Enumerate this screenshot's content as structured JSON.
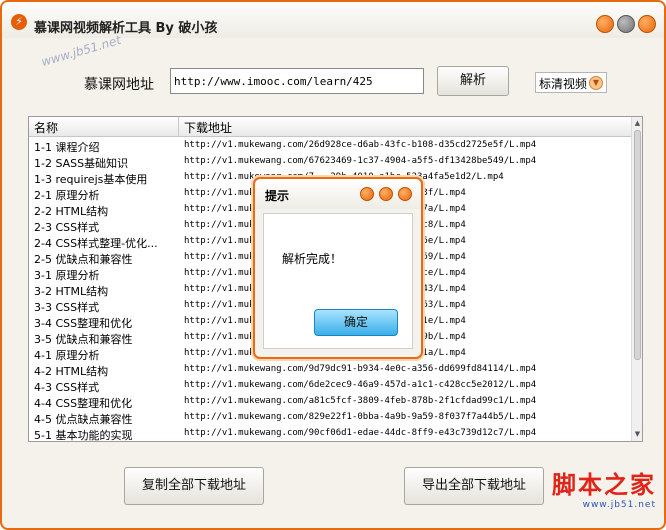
{
  "window": {
    "title": "慕课网视频解析工具 By 破小孩",
    "app_icon_glyph": "⚡",
    "watermark": "www.jb51.net"
  },
  "form": {
    "url_label": "慕课网地址",
    "url_value": "http://www.imooc.com/learn/425",
    "parse_button": "解析",
    "quality_selected": "标清视频"
  },
  "list": {
    "headers": {
      "name": "名称",
      "url": "下载地址"
    },
    "rows": [
      {
        "name": "1-1 课程介绍",
        "url": "http://v1.mukewang.com/26d928ce-d6ab-43fc-b108-d35cd2725e5f/L.mp4"
      },
      {
        "name": "1-2 SASS基础知识",
        "url": "http://v1.mukewang.com/67623469-1c37-4904-a5f5-df13428be549/L.mp4"
      },
      {
        "name": "1-3 requirejs基本使用",
        "url": "http://v1.mukewang.com/7...29b-4010-a1bc-523a4fa5e1d2/L.mp4"
      },
      {
        "name": "2-1 原理分析",
        "url": "http://v1.mukewang.com/...ae-a4f3-bef4d6c66a3f/L.mp4"
      },
      {
        "name": "2-2 HTML结构",
        "url": "http://v1.mukewang.com/...79-ab53-ecaa0d05497a/L.mp4"
      },
      {
        "name": "2-3 CSS样式",
        "url": "http://v1.mukewang.com/...43-874d-fddefe4347c8/L.mp4"
      },
      {
        "name": "2-4 CSS样式整理-优化...",
        "url": "http://v1.mukewang.com/...43-96e9-9693299f706e/L.mp4"
      },
      {
        "name": "2-5 优缺点和兼容性",
        "url": "http://v1.mukewang.com/...fd-98fb-f21667e65f69/L.mp4"
      },
      {
        "name": "3-1 原理分析",
        "url": "http://v1.mukewang.com/...ee-ac2c-ab5fac0104ce/L.mp4"
      },
      {
        "name": "3-2 HTML结构",
        "url": "http://v1.mukewang.com/...b0-8908-0624a6c41c43/L.mp4"
      },
      {
        "name": "3-3 CSS样式",
        "url": "http://v1.mukewang.com/...b1-888d-705993f85a63/L.mp4"
      },
      {
        "name": "3-4 CSS整理和优化",
        "url": "http://v1.mukewang.com/...98-9186-2ef2cb2d1b1e/L.mp4"
      },
      {
        "name": "3-5 优缺点和兼容性",
        "url": "http://v1.mukewang.com/...1a-9a92-475bed41019b/L.mp4"
      },
      {
        "name": "4-1 原理分析",
        "url": "http://v1.mukewang.com/...f1-a65d-dc7fbee6bc1a/L.mp4"
      },
      {
        "name": "4-2 HTML结构",
        "url": "http://v1.mukewang.com/9d79dc91-b934-4e0c-a356-dd699fd84114/L.mp4"
      },
      {
        "name": "4-3 CSS样式",
        "url": "http://v1.mukewang.com/6de2cec9-46a9-457d-a1c1-c428cc5e2012/L.mp4"
      },
      {
        "name": "4-4 CSS整理和优化",
        "url": "http://v1.mukewang.com/a81c5fcf-3809-4feb-878b-2f1cfdad99c1/L.mp4"
      },
      {
        "name": "4-5 优点缺点兼容性",
        "url": "http://v1.mukewang.com/829e22f1-0bba-4a9b-9a59-8f037f7a44b5/L.mp4"
      },
      {
        "name": "5-1 基本功能的实现",
        "url": "http://v1.mukewang.com/90cf06d1-edae-44dc-8ff9-e43c739d12c7/L.mp4"
      }
    ]
  },
  "actions": {
    "copy_all": "复制全部下载地址",
    "export_all": "导出全部下载地址"
  },
  "dialog": {
    "title": "提示",
    "message": "解析完成！",
    "ok_button": "确定"
  },
  "logo": {
    "main": "脚本之家",
    "sub": "www.jb51.net"
  }
}
